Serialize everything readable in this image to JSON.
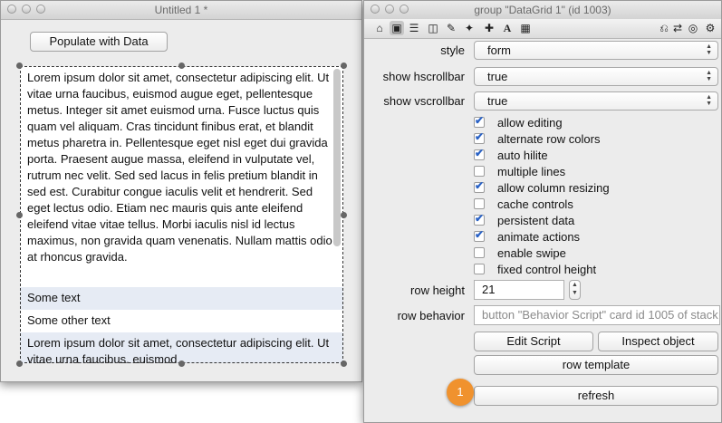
{
  "left_window": {
    "title": "Untitled 1 *",
    "populate_button": "Populate with Data",
    "grid_rows": [
      "Lorem ipsum dolor sit amet, consectetur adipiscing elit. Ut vitae urna faucibus, euismod augue eget, pellentesque metus. Integer sit amet euismod urna. Fusce luctus quis quam vel aliquam. Cras tincidunt finibus erat, et blandit metus pharetra in. Pellentesque eget nisl eget dui gravida porta. Praesent augue massa, eleifend in vulputate vel, rutrum nec velit. Sed sed lacus in felis pretium blandit in sed est. Curabitur congue iaculis velit et hendrerit. Sed eget lectus odio. Etiam nec mauris quis ante eleifend eleifend vitae vitae tellus. Morbi iaculis nisl id lectus maximus, non gravida quam venenatis. Nullam mattis odio at rhoncus gravida.",
      "Some text",
      "Some other text",
      "Lorem ipsum dolor sit amet, consectetur adipiscing elit. Ut vitae urna faucibus, euismod"
    ]
  },
  "right_window": {
    "title": "group \"DataGrid 1\" (id 1003)",
    "toolbar_icons": [
      "home-icon",
      "card-icon",
      "list-icon",
      "database-icon",
      "pencil-icon",
      "wand-icon",
      "move-icon",
      "text-icon",
      "grid-icon",
      "lock-icon",
      "unlink-icon",
      "target-icon",
      "gear-icon"
    ],
    "style": {
      "label": "style",
      "value": "form"
    },
    "show_hscrollbar": {
      "label": "show hscrollbar",
      "value": "true"
    },
    "show_vscrollbar": {
      "label": "show vscrollbar",
      "value": "true"
    },
    "checkboxes": [
      {
        "label": "allow editing",
        "checked": true
      },
      {
        "label": "alternate row colors",
        "checked": true
      },
      {
        "label": "auto hilite",
        "checked": true
      },
      {
        "label": "multiple lines",
        "checked": false
      },
      {
        "label": "allow column resizing",
        "checked": true
      },
      {
        "label": "cache controls",
        "checked": false
      },
      {
        "label": "persistent data",
        "checked": true
      },
      {
        "label": "animate actions",
        "checked": true
      },
      {
        "label": "enable swipe",
        "checked": false
      },
      {
        "label": "fixed control height",
        "checked": false
      }
    ],
    "row_height": {
      "label": "row height",
      "value": "21"
    },
    "row_behavior": {
      "label": "row behavior",
      "value": "button \"Behavior Script\" card  id 1005 of stack"
    },
    "edit_script_button": "Edit Script",
    "inspect_object_button": "Inspect object",
    "row_template_button": "row template",
    "refresh_button": "refresh",
    "badge": "1"
  }
}
